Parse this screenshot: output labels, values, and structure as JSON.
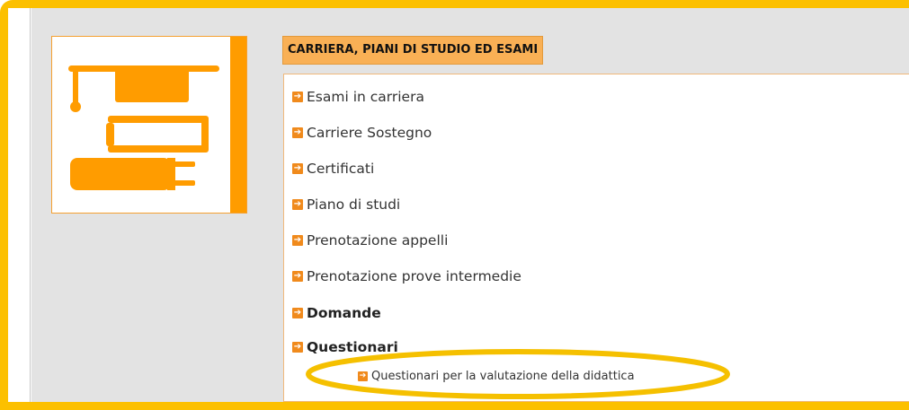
{
  "section": {
    "title": "CARRIERA, PIANI DI STUDIO ED ESAMI",
    "icon": "graduation-books-icon"
  },
  "menu": {
    "items": [
      {
        "label": "Esami in carriera",
        "bold": false
      },
      {
        "label": "Carriere Sostegno",
        "bold": false
      },
      {
        "label": "Certificati",
        "bold": false
      },
      {
        "label": "Piano di studi",
        "bold": false
      },
      {
        "label": "Prenotazione appelli",
        "bold": false
      },
      {
        "label": "Prenotazione prove intermedie",
        "bold": false
      },
      {
        "label": "Domande",
        "bold": true
      },
      {
        "label": "Questionari",
        "bold": true
      }
    ],
    "subitem": {
      "label": "Questionari per la valutazione della didattica"
    }
  },
  "colors": {
    "frame": "#fcc000",
    "accent": "#ff9c00",
    "arrow": "#f08a1c",
    "highlight": "#f5c000"
  }
}
